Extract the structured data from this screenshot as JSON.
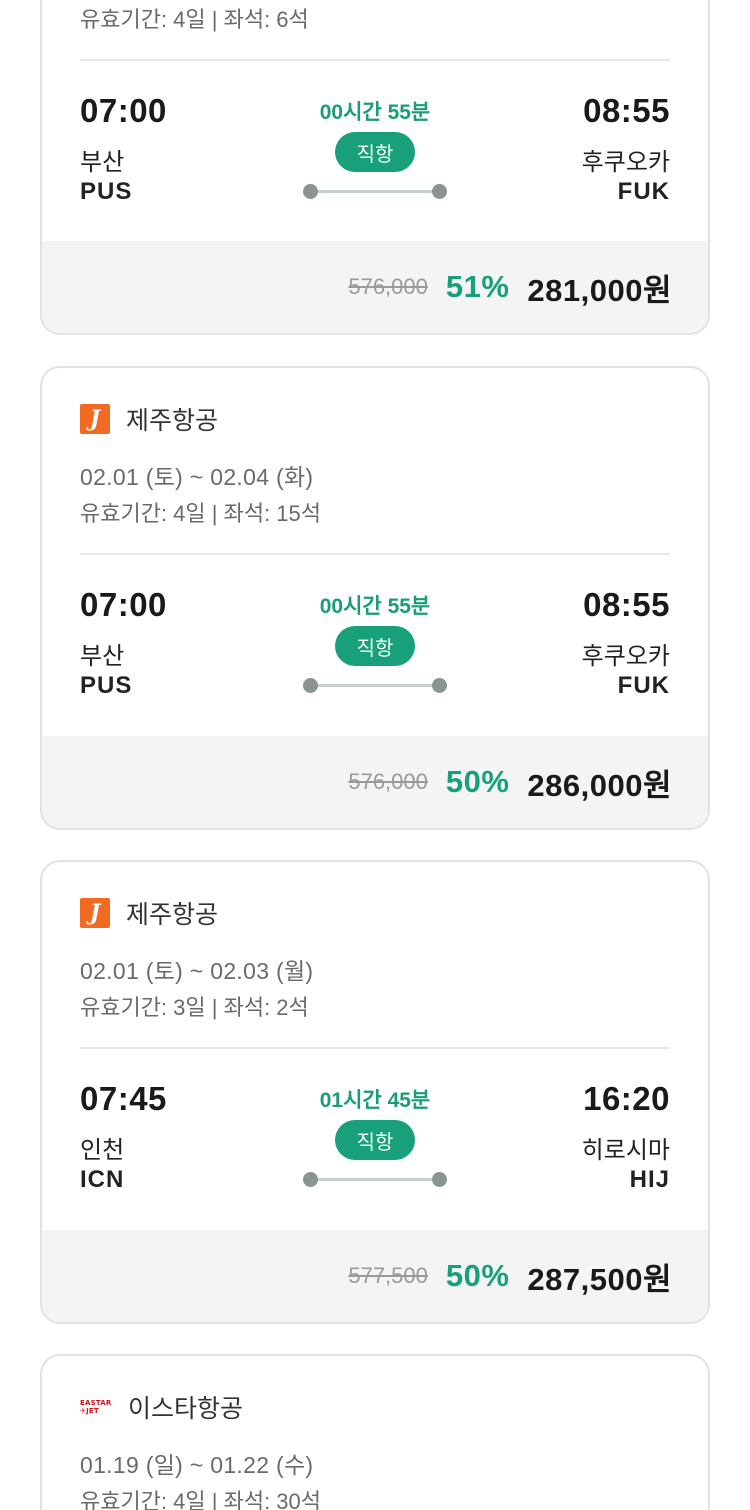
{
  "cards": [
    {
      "airline": "",
      "dates": "",
      "validity": "유효기간: 4일 | 좌석: 6석",
      "flight": {
        "dep_time": "07:00",
        "dep_city": "부산",
        "dep_code": "PUS",
        "duration": "00시간 55분",
        "type": "직항",
        "arr_time": "08:55",
        "arr_city": "후쿠오카",
        "arr_code": "FUK"
      },
      "price": {
        "original": "576,000",
        "discount": "51%",
        "final": "281,000원"
      }
    },
    {
      "airline": "제주항공",
      "airline_logo": "jeju-air-logo",
      "dates": "02.01 (토) ~ 02.04 (화)",
      "validity": "유효기간: 4일 | 좌석: 15석",
      "flight": {
        "dep_time": "07:00",
        "dep_city": "부산",
        "dep_code": "PUS",
        "duration": "00시간 55분",
        "type": "직항",
        "arr_time": "08:55",
        "arr_city": "후쿠오카",
        "arr_code": "FUK"
      },
      "price": {
        "original": "576,000",
        "discount": "50%",
        "final": "286,000원"
      }
    },
    {
      "airline": "제주항공",
      "airline_logo": "jeju-air-logo",
      "dates": "02.01 (토) ~ 02.03 (월)",
      "validity": "유효기간: 3일 | 좌석: 2석",
      "flight": {
        "dep_time": "07:45",
        "dep_city": "인천",
        "dep_code": "ICN",
        "duration": "01시간 45분",
        "type": "직항",
        "arr_time": "16:20",
        "arr_city": "히로시마",
        "arr_code": "HIJ"
      },
      "price": {
        "original": "577,500",
        "discount": "50%",
        "final": "287,500원"
      }
    },
    {
      "airline": "이스타항공",
      "airline_logo": "eastar-jet-logo",
      "airline_logo_text": "EASTAR✈JET",
      "dates": "01.19 (일) ~ 01.22 (수)",
      "validity": "유효기간: 4일 | 좌석: 30석"
    }
  ],
  "colors": {
    "accent": "#17a07a",
    "jeju": "#f26a21",
    "eastar": "#d6141d"
  }
}
